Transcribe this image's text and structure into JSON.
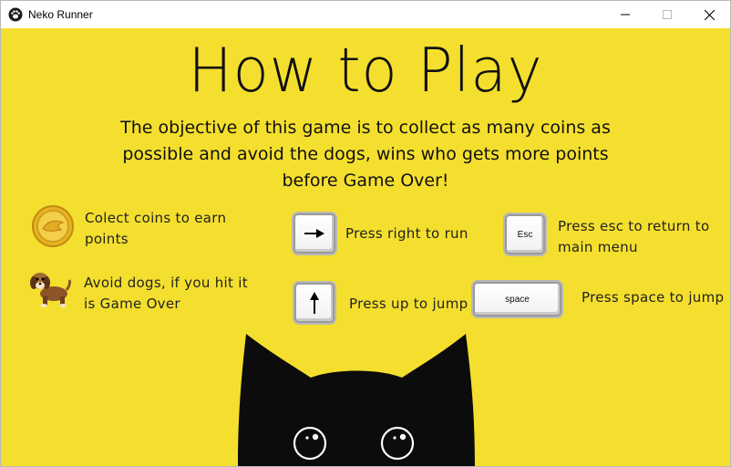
{
  "window": {
    "title": "Neko Runner",
    "icon": "paw-icon",
    "controls": [
      "minimize-icon",
      "maximize-icon",
      "close-icon"
    ]
  },
  "screen": {
    "background": "#f5df2e",
    "heading": "How to Play",
    "objective": "The objective of this game is to collect as many coins as possible  and avoid the dogs, wins who gets more points before Game Over!"
  },
  "instructions": {
    "coins": {
      "icon": "coin-icon",
      "text": "Colect coins to earn points"
    },
    "dogs": {
      "icon": "dog-icon",
      "text": "Avoid dogs, if you hit it is Game Over"
    },
    "right": {
      "key_icon": "arrow-right-icon",
      "text": "Press right to run"
    },
    "up": {
      "key_icon": "arrow-up-icon",
      "text": "Press up to jump"
    },
    "esc": {
      "key": "Esc",
      "text": "Press esc to return to main menu"
    },
    "space": {
      "key": "space",
      "text": "Press space to jump"
    }
  },
  "decoration": {
    "cat": "cat-silhouette-icon"
  }
}
